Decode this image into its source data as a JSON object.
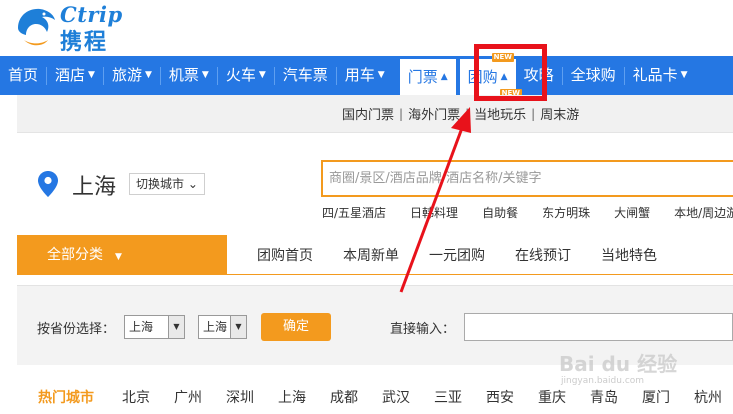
{
  "header": {
    "logo_en": "Ctrip",
    "logo_cn": "携程"
  },
  "nav": {
    "items": [
      {
        "label": "首页",
        "caret": false
      },
      {
        "label": "酒店",
        "caret": true
      },
      {
        "label": "旅游",
        "caret": true
      },
      {
        "label": "机票",
        "caret": true
      },
      {
        "label": "火车",
        "caret": true
      },
      {
        "label": "汽车票",
        "caret": false
      },
      {
        "label": "用车",
        "caret": true
      },
      {
        "label": "门票",
        "caret": true
      },
      {
        "label": "团购",
        "caret": true
      },
      {
        "label": "攻略",
        "caret": false
      },
      {
        "label": "全球购",
        "caret": false
      },
      {
        "label": "礼品卡",
        "caret": true
      }
    ],
    "new_badge": "NEW",
    "caret_down": "▼",
    "caret_up": "▲"
  },
  "subnav": {
    "items": [
      "国内门票",
      "海外门票",
      "当地玩乐",
      "周末游"
    ],
    "separator": "|"
  },
  "location": {
    "city": "上海",
    "switch_label": "切换城市",
    "switch_caret": "⌄"
  },
  "search": {
    "placeholder": "商圈/景区/酒店品牌/酒店名称/关键字",
    "hot_words": [
      "四/五星酒店",
      "日韩料理",
      "自助餐",
      "东方明珠",
      "大闸蟹",
      "本地/周边游"
    ]
  },
  "category": {
    "all_label": "全部分类",
    "tabs": [
      "团购首页",
      "本周新单",
      "一元团购",
      "在线预订",
      "当地特色"
    ]
  },
  "province_filter": {
    "label": "按省份选择：",
    "province_value": "上海",
    "city_value": "上海",
    "confirm_label": "确定",
    "direct_label": "直接输入："
  },
  "hot_cities": {
    "label": "热门城市",
    "cities": [
      "北京",
      "广州",
      "深圳",
      "上海",
      "成都",
      "武汉",
      "三亚",
      "西安",
      "重庆",
      "青岛",
      "厦门",
      "杭州"
    ]
  },
  "watermark": {
    "logo": "Bai du 经验",
    "sub": "jingyan.baidu.com"
  },
  "colors": {
    "brand_blue": "#2577e3",
    "accent_orange": "#f39a1e",
    "annotation_red": "#e8121b"
  }
}
